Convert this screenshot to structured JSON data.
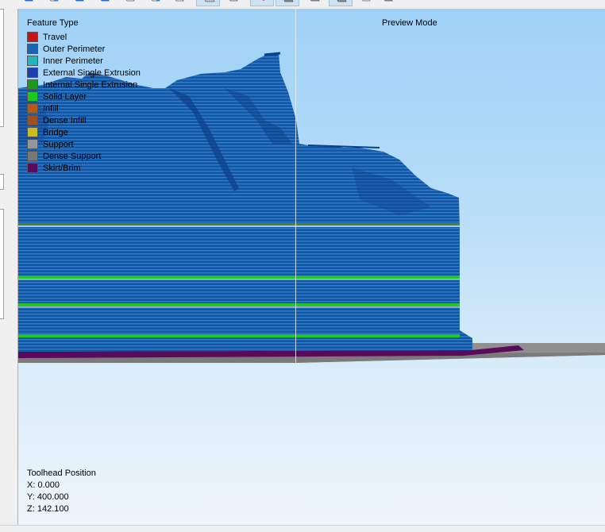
{
  "viewport": {
    "preview_mode_label": "Preview Mode",
    "legend": {
      "title": "Feature Type",
      "items": [
        {
          "label": "Travel",
          "color": "#c81414"
        },
        {
          "label": "Outer Perimeter",
          "color": "#1a64b4"
        },
        {
          "label": "Inner Perimeter",
          "color": "#1fb4be"
        },
        {
          "label": "External Single Extrusion",
          "color": "#1b3fae"
        },
        {
          "label": "Internal Single Extrusion",
          "color": "#1a9a1a"
        },
        {
          "label": "Solid Layer",
          "color": "#1ec81e"
        },
        {
          "label": "Infill",
          "color": "#b45a14"
        },
        {
          "label": "Dense Infill",
          "color": "#a04f1e"
        },
        {
          "label": "Bridge",
          "color": "#c8be1e"
        },
        {
          "label": "Support",
          "color": "#969696"
        },
        {
          "label": "Dense Support",
          "color": "#787878"
        },
        {
          "label": "Skirt/Brim",
          "color": "#5a0a5a"
        }
      ]
    },
    "toolhead": {
      "title": "Toolhead Position",
      "x": "X: 0.000",
      "y": "Y: 400.000",
      "z": "Z: 142.100"
    }
  },
  "toolbar": {
    "icons": [
      {
        "name": "view-cube-icon-1",
        "color": "#2a7fd4"
      },
      {
        "name": "view-cube-icon-2",
        "color": "#2a7fd4"
      },
      {
        "name": "view-cube-icon-3",
        "color": "#2a7fd4"
      },
      {
        "name": "view-cube-icon-4",
        "color": "#2a7fd4"
      },
      {
        "name": "view-cube-icon-5",
        "color": "#ffffff"
      },
      {
        "name": "view-cube-icon-6",
        "color": "#2a7fd4"
      },
      {
        "name": "show-model-icon",
        "color": "#c0c0c0"
      },
      {
        "name": "show-toolpath-icon",
        "color": "#c0c0c0"
      },
      {
        "name": "travel-moves-icon",
        "color": "#cc2020"
      },
      {
        "name": "solid-view-icon",
        "color": "#8a8a8a"
      },
      {
        "name": "wireframe-view-icon",
        "color": "#8a8a8a"
      },
      {
        "name": "layer-view-icon",
        "color": "#8a8a8a"
      },
      {
        "name": "mesh-view-icon",
        "color": "#c0c0c0"
      },
      {
        "name": "bed-view-icon",
        "color": "#8a8a8a"
      }
    ]
  }
}
